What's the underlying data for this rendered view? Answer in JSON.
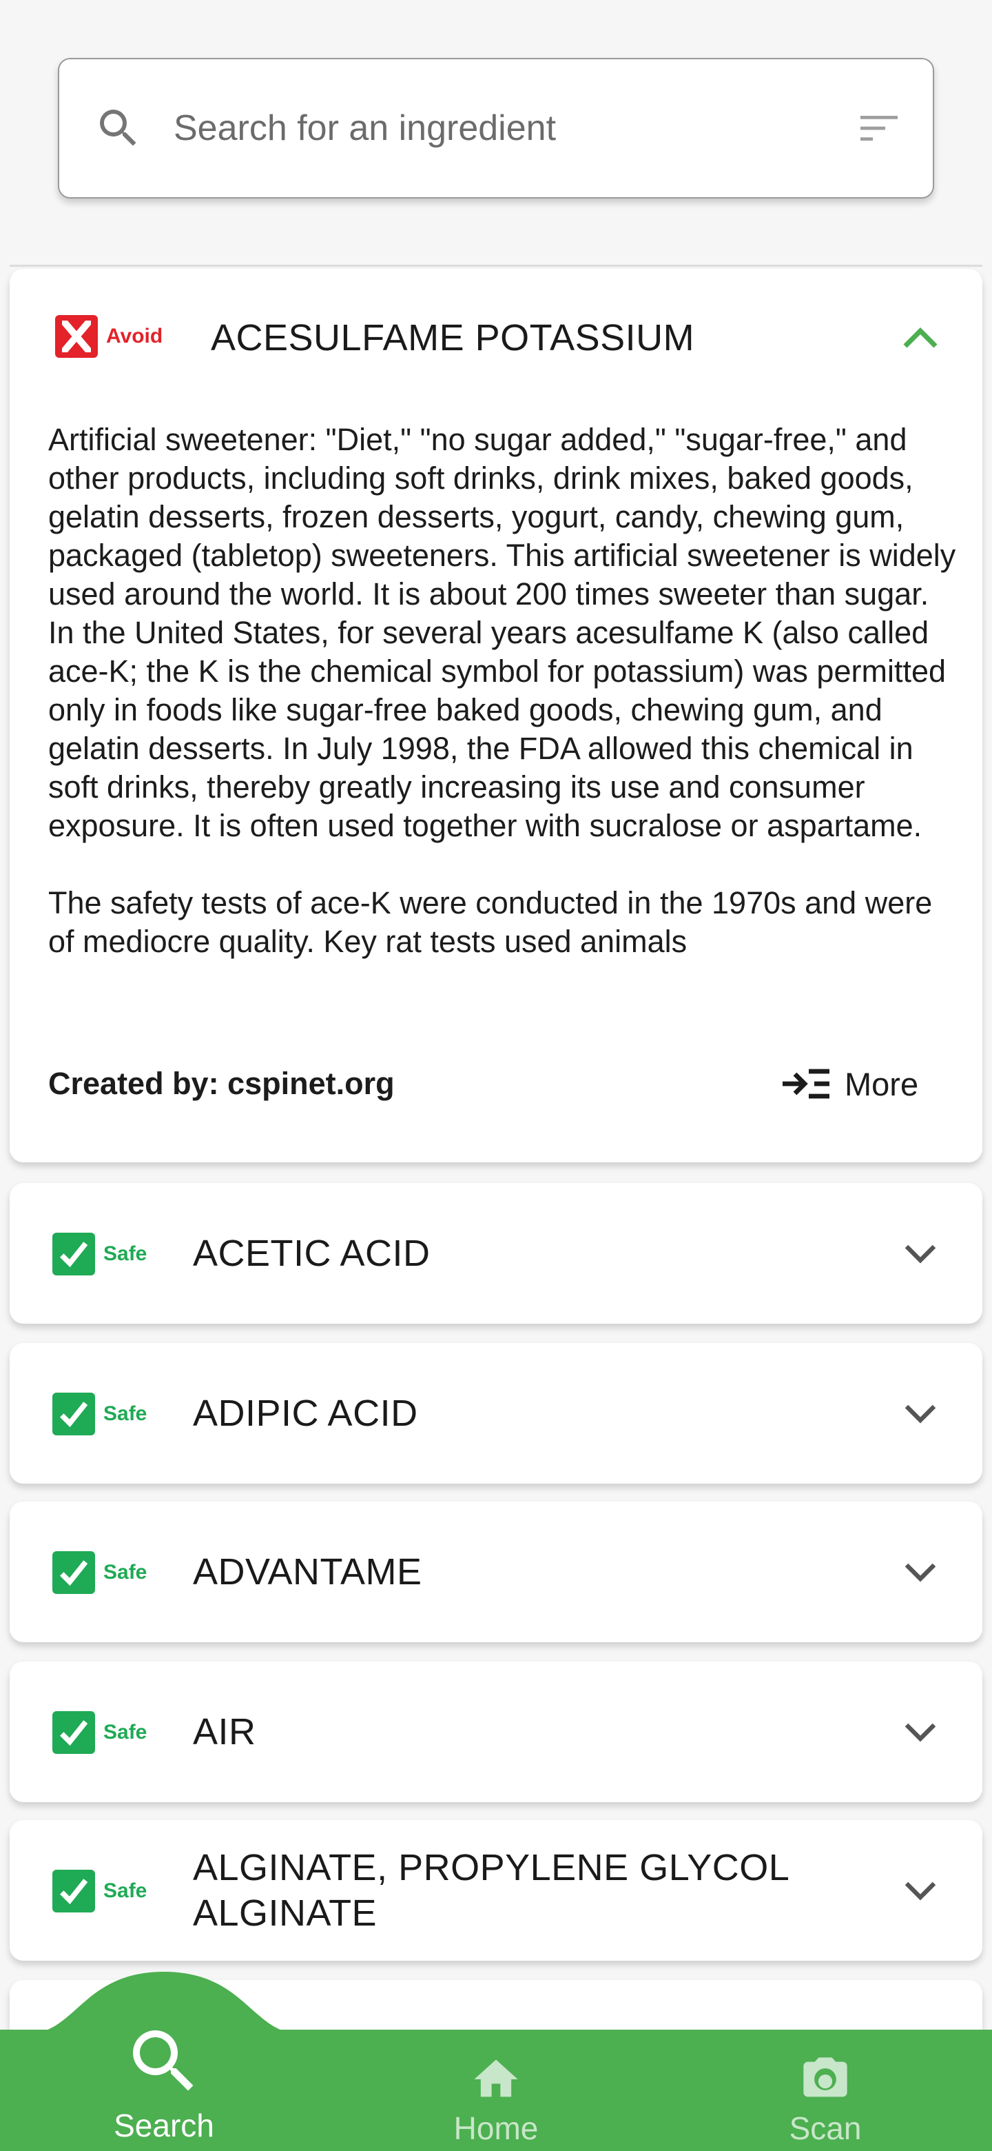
{
  "search": {
    "placeholder": "Search for an ingredient",
    "icon": "search-icon",
    "filter_icon": "filter-list-icon"
  },
  "expanded_item": {
    "rating": "Avoid",
    "name": "ACESULFAME POTASSIUM",
    "description_1": "Artificial sweetener: \"Diet,\" \"no sugar added,\" \"sugar-free,\" and other products, including soft drinks, drink mixes, baked goods, gelatin desserts, frozen desserts, yogurt, candy, chewing gum, packaged (tabletop) sweeteners. This artificial sweetener is widely used around the world. It is about 200 times sweeter than sugar. In the United States, for several years acesulfame K (also called ace-K; the K is the chemical symbol for potassium) was permitted only in foods like sugar-free baked goods, chewing gum, and gelatin desserts. In July 1998, the FDA allowed this chemical in soft drinks, thereby greatly increasing its use and consumer exposure. It is often used together with sucralose or aspartame.",
    "description_2": "The safety tests of ace-K were conducted in the 1970s and were of mediocre quality. Key rat tests used animals",
    "created_by": "Created by: cspinet.org",
    "more_label": "More"
  },
  "items": [
    {
      "rating": "Safe",
      "name": "ACETIC ACID"
    },
    {
      "rating": "Safe",
      "name": "ADIPIC ACID"
    },
    {
      "rating": "Safe",
      "name": "ADVANTAME"
    },
    {
      "rating": "Safe",
      "name": "AIR"
    },
    {
      "rating": "Safe",
      "name": "ALGINATE, PROPYLENE GLYCOL ALGINATE"
    }
  ],
  "nav": {
    "search": "Search",
    "home": "Home",
    "scan": "Scan"
  },
  "colors": {
    "avoid": "#e32229",
    "safe": "#1faa55",
    "nav_green": "#4caf50",
    "chevron_up": "#4caf50"
  }
}
